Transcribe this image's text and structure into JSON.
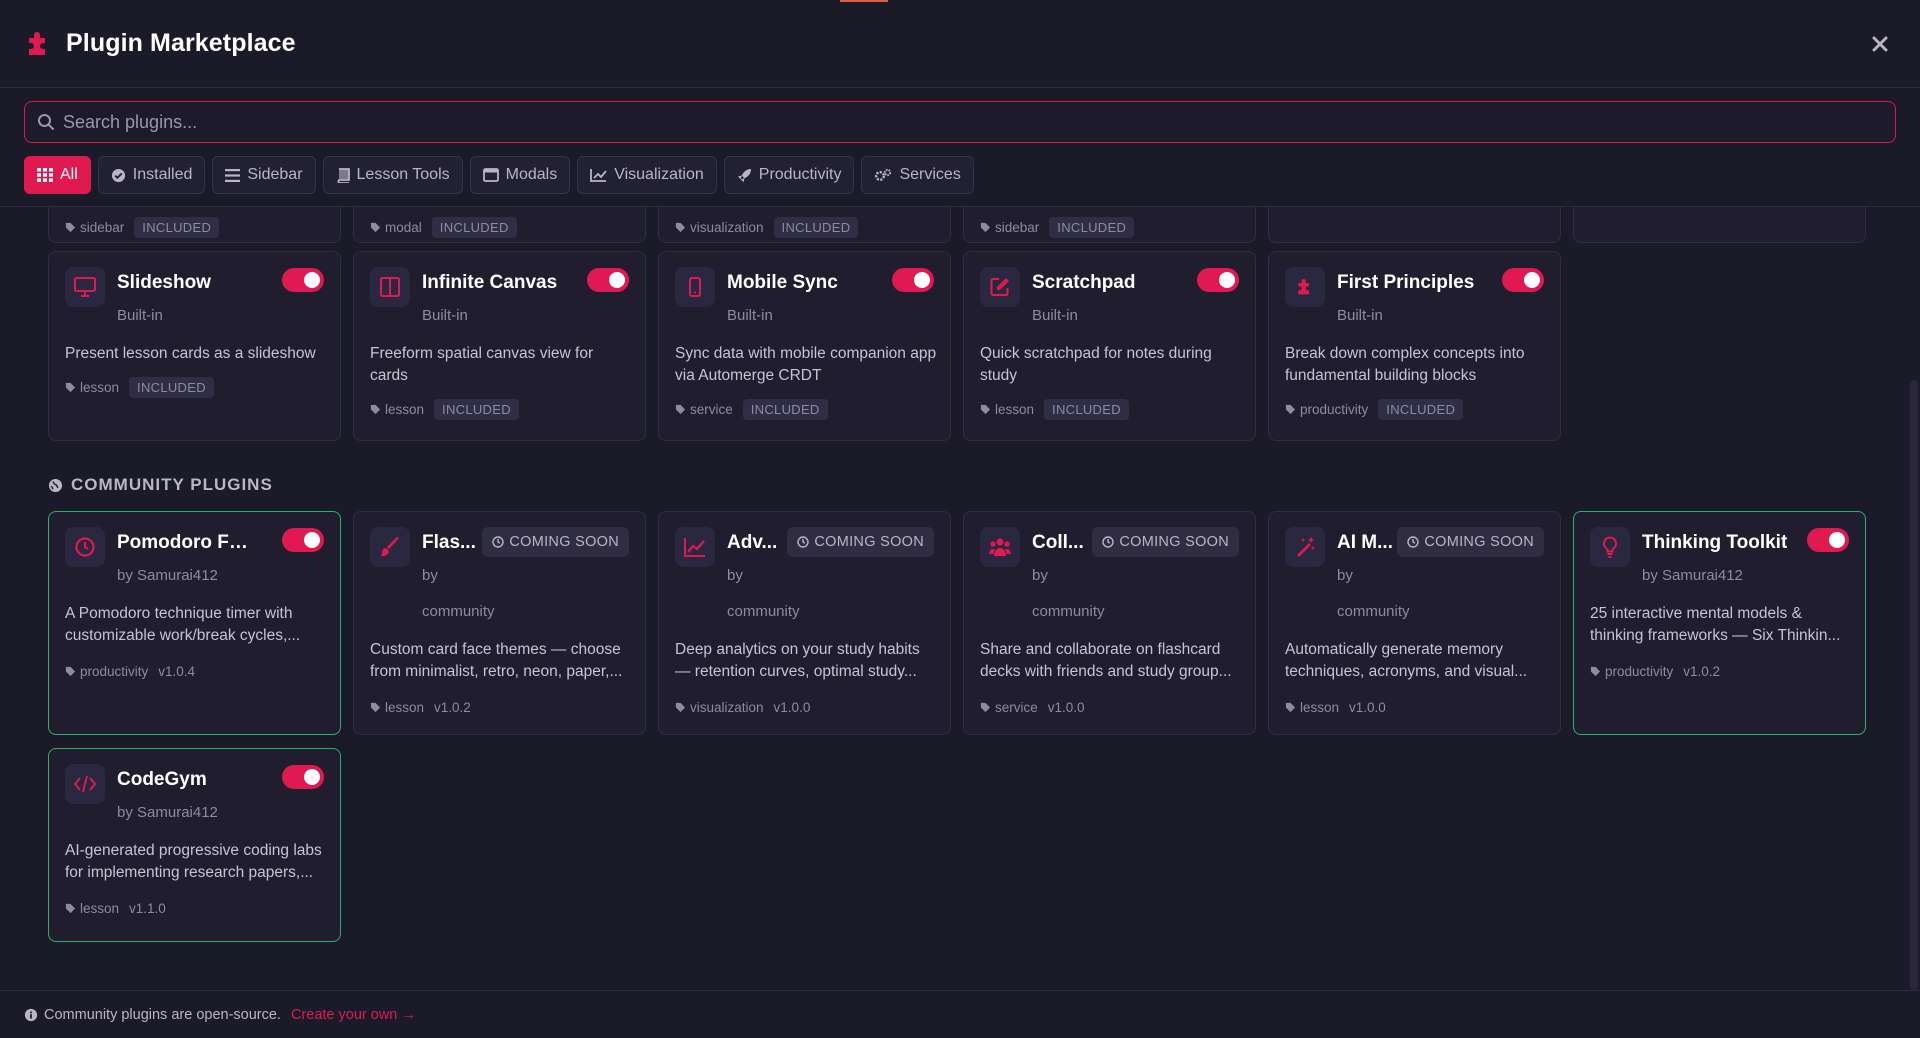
{
  "header": {
    "title": "Plugin Marketplace"
  },
  "search": {
    "placeholder": "Search plugins..."
  },
  "filters": [
    {
      "label": "All",
      "icon": "grid-icon",
      "active": true
    },
    {
      "label": "Installed",
      "icon": "check-circle-icon"
    },
    {
      "label": "Sidebar",
      "icon": "bars-icon"
    },
    {
      "label": "Lesson Tools",
      "icon": "book-icon"
    },
    {
      "label": "Modals",
      "icon": "window-icon"
    },
    {
      "label": "Visualization",
      "icon": "chart-line-icon"
    },
    {
      "label": "Productivity",
      "icon": "rocket-icon"
    },
    {
      "label": "Services",
      "icon": "cogs-icon"
    }
  ],
  "partial_row": [
    {
      "category": "sidebar",
      "badge": "INCLUDED"
    },
    {
      "category": "modal",
      "badge": "INCLUDED"
    },
    {
      "category": "visualization",
      "badge": "INCLUDED"
    },
    {
      "category": "sidebar",
      "badge": "INCLUDED"
    }
  ],
  "builtin": [
    {
      "name": "Slideshow",
      "author": "Built-in",
      "desc": "Present lesson cards as a slideshow",
      "category": "lesson",
      "badge": "INCLUDED",
      "icon": "monitor-icon"
    },
    {
      "name": "Infinite Canvas",
      "author": "Built-in",
      "desc": "Freeform spatial canvas view for cards",
      "category": "lesson",
      "badge": "INCLUDED",
      "icon": "columns-icon"
    },
    {
      "name": "Mobile Sync",
      "author": "Built-in",
      "desc": "Sync data with mobile companion app via Automerge CRDT",
      "category": "service",
      "badge": "INCLUDED",
      "icon": "mobile-icon"
    },
    {
      "name": "Scratchpad",
      "author": "Built-in",
      "desc": "Quick scratchpad for notes during study",
      "category": "lesson",
      "badge": "INCLUDED",
      "icon": "edit-icon"
    },
    {
      "name": "First Principles",
      "author": "Built-in",
      "desc": "Break down complex concepts into fundamental building blocks",
      "category": "productivity",
      "badge": "INCLUDED",
      "icon": "puzzle-icon"
    }
  ],
  "community_title": "COMMUNITY PLUGINS",
  "community": [
    {
      "name": "Pomodoro Focus ...",
      "author": "by Samurai412",
      "desc": "A Pomodoro technique timer with customizable work/break cycles,...",
      "category": "productivity",
      "version": "v1.0.4",
      "icon": "clock-icon"
    },
    {
      "name": "Flas...",
      "author": "by",
      "author2": "community",
      "desc": "Custom card face themes — choose from minimalist, retro, neon, paper,...",
      "category": "lesson",
      "version": "v1.0.2",
      "coming": "COMING SOON",
      "icon": "paint-brush-icon"
    },
    {
      "name": "Adv...",
      "author": "by",
      "author2": "community",
      "desc": "Deep analytics on your study habits — retention curves, optimal study...",
      "category": "visualization",
      "version": "v1.0.0",
      "coming": "COMING SOON",
      "icon": "chart-area-icon"
    },
    {
      "name": "Coll...",
      "author": "by",
      "author2": "community",
      "desc": "Share and collaborate on flashcard decks with friends and study group...",
      "category": "service",
      "version": "v1.0.0",
      "coming": "COMING SOON",
      "icon": "users-icon"
    },
    {
      "name": "AI M...",
      "author": "by",
      "author2": "community",
      "desc": "Automatically generate memory techniques, acronyms, and visual...",
      "category": "lesson",
      "version": "v1.0.0",
      "coming": "COMING SOON",
      "icon": "magic-wand-icon"
    },
    {
      "name": "Thinking Toolkit",
      "author": "by Samurai412",
      "desc": "25 interactive mental models & thinking frameworks — Six Thinkin...",
      "category": "productivity",
      "version": "v1.0.2",
      "icon": "lightbulb-icon"
    },
    {
      "name": "CodeGym",
      "author": "by Samurai412",
      "desc": "AI-generated progressive coding labs for implementing research papers,...",
      "category": "lesson",
      "version": "v1.1.0",
      "icon": "code-icon"
    }
  ],
  "footer": {
    "text": "Community plugins are open-source.",
    "link": "Create your own →"
  },
  "colors": {
    "accent": "#e01a50",
    "installed_border": "#2fae6a",
    "background": "#1b1a29"
  }
}
